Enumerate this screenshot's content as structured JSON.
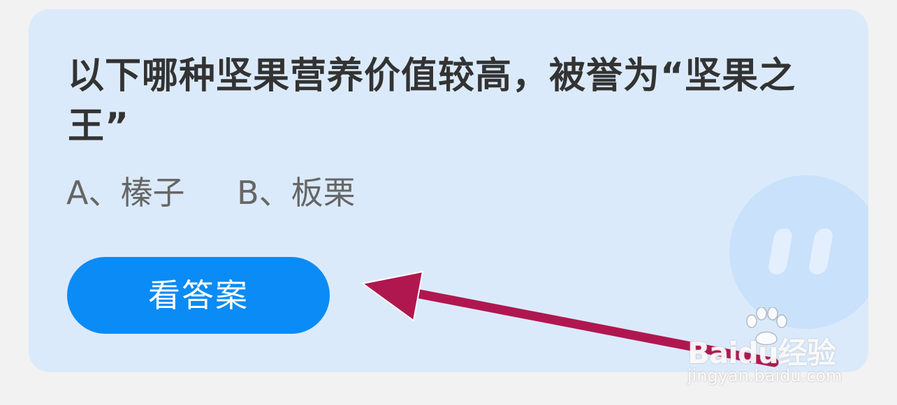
{
  "quiz": {
    "question": "以下哪种坚果营养价值较高，被誉为“坚果之王”",
    "options": [
      {
        "label": "A、榛子"
      },
      {
        "label": "B、板栗"
      }
    ],
    "answer_button": "看答案"
  },
  "watermark": {
    "brand": "Baidu经验",
    "url": "jingyan.baidu.com"
  },
  "annotation": {
    "arrow_color": "#b0174f",
    "arrow_icon": "arrow-left-icon"
  },
  "colors": {
    "page_background": "#f2f2f2",
    "card_background": "#dbeafb",
    "button_background": "#0a8bf5",
    "question_text": "#333333",
    "option_text": "#666666"
  }
}
